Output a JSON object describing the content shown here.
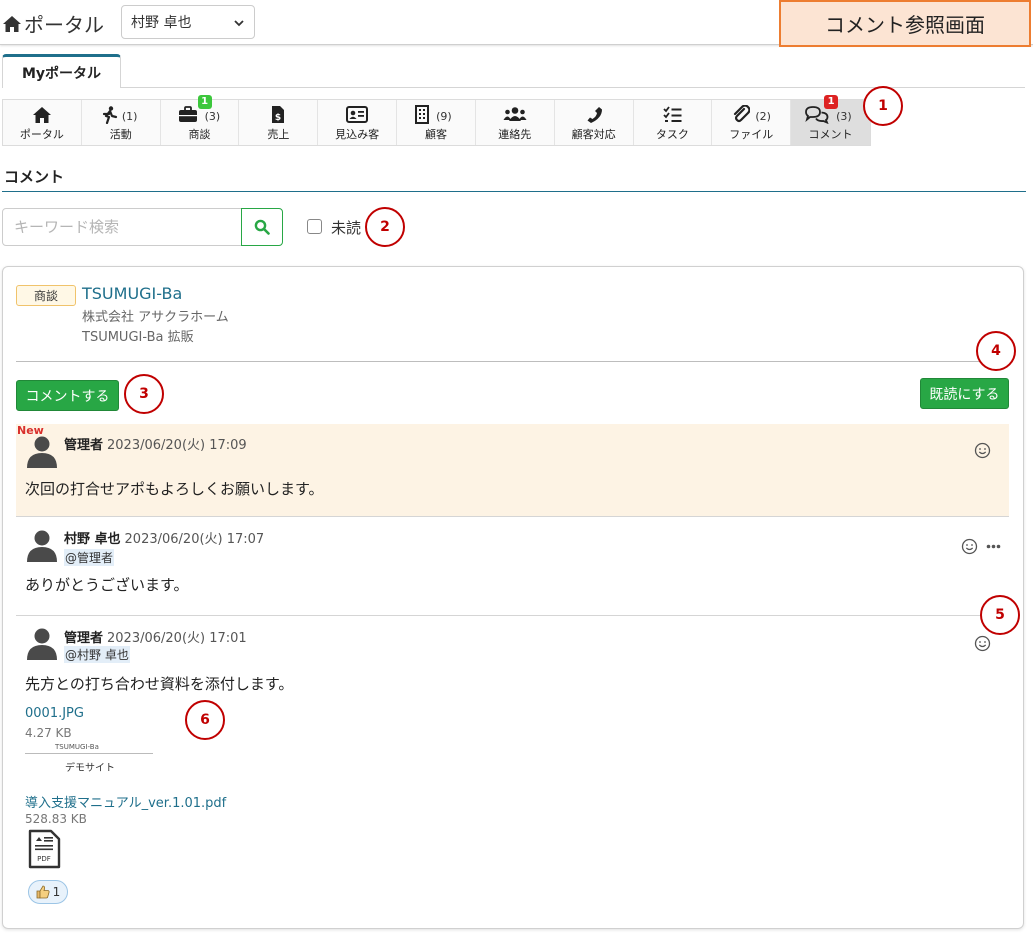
{
  "header": {
    "brand": "ポータル",
    "user_select": "村野 卓也",
    "screen_title": "コメント参照画面"
  },
  "tabs": [
    {
      "label": "Myポータル",
      "active": true
    }
  ],
  "menu": {
    "items": [
      {
        "label": "ポータル",
        "icon": "home-icon"
      },
      {
        "label": "活動",
        "icon": "running-icon",
        "count": "(1)"
      },
      {
        "label": "商談",
        "icon": "briefcase-icon",
        "count": "(3)",
        "badge": "1",
        "badge_color": "#3cc73c"
      },
      {
        "label": "売上",
        "icon": "invoice-icon"
      },
      {
        "label": "見込み客",
        "icon": "id-card-icon"
      },
      {
        "label": "顧客",
        "icon": "building-icon",
        "count": "(9)"
      },
      {
        "label": "連絡先",
        "icon": "users-icon"
      },
      {
        "label": "顧客対応",
        "icon": "phone-icon"
      },
      {
        "label": "タスク",
        "icon": "tasks-icon"
      },
      {
        "label": "ファイル",
        "icon": "paperclip-icon",
        "count": "(2)"
      },
      {
        "label": "コメント",
        "icon": "comments-icon",
        "count": "(3)",
        "badge": "1",
        "badge_color": "#dd2222",
        "active": true
      }
    ]
  },
  "section": {
    "title": "コメント"
  },
  "search": {
    "placeholder": "キーワード検索",
    "unread_label": "未読"
  },
  "callouts": [
    "1",
    "2",
    "3",
    "4",
    "5",
    "6"
  ],
  "deal": {
    "tag": "商談",
    "name": "TSUMUGI-Ba",
    "company": "株式会社 アサクラホーム",
    "subtitle": "TSUMUGI-Ba 拡販"
  },
  "buttons": {
    "comment": "コメントする",
    "mark_read": "既読にする"
  },
  "comments": [
    {
      "new_label": "New",
      "author": "管理者",
      "datetime": "2023/06/20(火) 17:09",
      "body": "次回の打合せアポもよろしくお願いします。"
    },
    {
      "author": "村野 卓也",
      "datetime": "2023/06/20(火) 17:07",
      "mention": "@管理者",
      "body": "ありがとうございます。"
    },
    {
      "author": "管理者",
      "datetime": "2023/06/20(火) 17:01",
      "mention": "@村野 卓也",
      "body": "先方との打ち合わせ資料を添付します。",
      "attachments": [
        {
          "name": "0001.JPG",
          "size": "4.27 KB",
          "thumb_logo": "TSUMUGI-Ba",
          "thumb_caption": "デモサイト"
        },
        {
          "name": "導入支援マニュアル_ver.1.01.pdf",
          "size": "528.83 KB",
          "icon_label": "PDF"
        }
      ],
      "reaction": {
        "icon": "thumbs-up-icon",
        "count": "1"
      }
    }
  ],
  "colors": {
    "accent": "#1f6f8b",
    "button_green": "#28a745",
    "new_bg": "#fdf3e4",
    "callout": "#c00000",
    "title_box": "#fce4d3"
  }
}
